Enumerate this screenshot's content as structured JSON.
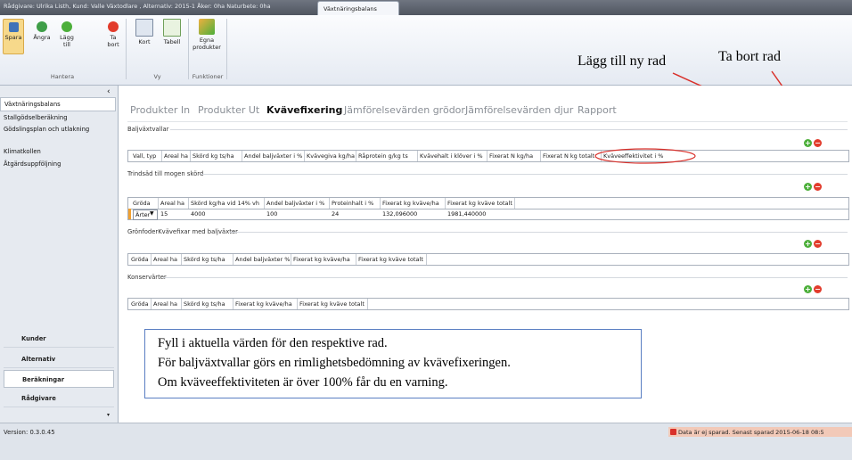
{
  "window": {
    "title_text": "Rådgivare: Ulrika Listh, Kund:  Valle Växtodlare , Alternativ:  2015-1  Åker: 0ha Naturbete: 0ha",
    "active_tab": "Växtnäringsbalans"
  },
  "ribbon": {
    "spara": "Spara",
    "angra": "Ångra",
    "lagg_till": "Lägg till",
    "ta_bort": "Ta bort",
    "kort": "Kort",
    "tabell": "Tabell",
    "egna_produkter": "Egna produkter",
    "group_hantera": "Hantera",
    "group_vy": "Vy",
    "group_funktioner": "Funktioner"
  },
  "annotations": {
    "add_row": "Lägg till ny rad",
    "remove_row": "Ta bort rad"
  },
  "sidebar": {
    "collapse_glyph": "‹",
    "items": [
      {
        "label": "Växtnäringsbalans"
      },
      {
        "label": "Stallgödselberäkning"
      },
      {
        "label": "Gödslingsplan och utlakning"
      },
      {
        "label": "Klimatkollen"
      },
      {
        "label": "Åtgärdsuppföljning"
      }
    ],
    "bottom": [
      {
        "label": "Kunder"
      },
      {
        "label": "Alternativ"
      },
      {
        "label": "Beräkningar"
      },
      {
        "label": "Rådgivare"
      }
    ]
  },
  "tabs": [
    "Produkter In",
    "Produkter Ut",
    "Kvävefixering",
    "Jämförelsevärden grödor",
    "Jämförelsevärden djur",
    "Rapport"
  ],
  "sections": {
    "baljvaxtvallar": {
      "title": "Baljväxtvallar",
      "columns": [
        "Vall, typ",
        "Areal ha",
        "Skörd kg ts/ha",
        "Andel baljväxter i %",
        "Kvävegiva kg/ha",
        "Råprotein g/kg ts",
        "Kvävehalt i klöver i %",
        "Fixerat N kg/ha",
        "Fixerat N kg totalt",
        "Kväveeffektivitet i %"
      ]
    },
    "trindsad": {
      "title": "Trindsäd till mogen skörd",
      "columns": [
        "Gröda",
        "Areal ha",
        "Skörd kg/ha vid 14% vh",
        "Andel baljväxter i %",
        "Proteinhalt i %",
        "Fixerat kg kväve/ha",
        "Fixerat kg kväve totalt"
      ],
      "row": [
        "Ärter",
        "15",
        "4000",
        "100",
        "24",
        "132,096000",
        "1981,440000"
      ]
    },
    "gronfoder": {
      "title": "GrönfoderKvävefixar med baljväxter",
      "columns": [
        "Gröda",
        "Areal ha",
        "Skörd kg ts/ha",
        "Andel baljväxter %",
        "Fixerat kg kväve/ha",
        "Fixerat kg kväve totalt"
      ]
    },
    "konservarter": {
      "title": "Konservärter",
      "columns": [
        "Gröda",
        "Areal ha",
        "Skörd kg ts/ha",
        "Fixerat kg kväve/ha",
        "Fixerat kg kväve totalt"
      ]
    }
  },
  "infobox": {
    "line1": "Fyll i aktuella värden för den respektive rad.",
    "line2": "För baljväxtvallar görs en rimlighetsbedömning av kvävefixeringen.",
    "line3": "Om kväveeffektiviteten är över 100% får du en varning."
  },
  "status": {
    "version": "Version:  0.3.0.45",
    "save_status": "Data är ej sparad. Senast sparad 2015-06-18 08:5"
  },
  "colors": {
    "accent_orange": "#f0a030",
    "highlight_red": "#d9302a",
    "add_green": "#4caf3a"
  }
}
